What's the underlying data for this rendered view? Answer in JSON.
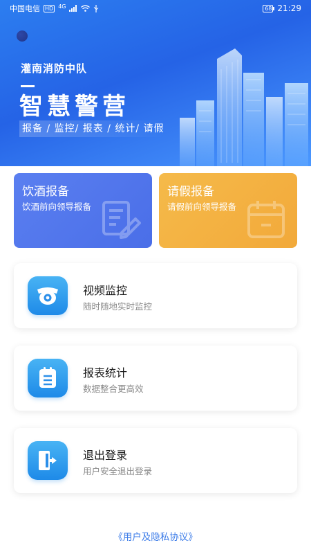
{
  "status_bar": {
    "carrier": "中国电信",
    "hd": "HD",
    "network": "4G",
    "battery": "68",
    "time": "21:29"
  },
  "hero": {
    "org": "灌南消防中队",
    "title": "智慧警营",
    "subtitle": "报备 / 监控/ 报表 / 统计/ 请假"
  },
  "top_cards": [
    {
      "title": "饮酒报备",
      "desc": "饮酒前向领导报备",
      "color": "#5a7ff0"
    },
    {
      "title": "请假报备",
      "desc": "请假前向领导报备",
      "color": "#f2a93a"
    }
  ],
  "menu": [
    {
      "title": "视频监控",
      "desc": "随时随地实时监控",
      "icon": "camera-icon"
    },
    {
      "title": "报表统计",
      "desc": "数据整合更高效",
      "icon": "document-icon"
    },
    {
      "title": "退出登录",
      "desc": "用户安全退出登录",
      "icon": "logout-icon"
    }
  ],
  "footer": {
    "link": "《用户及隐私协议》"
  },
  "colors": {
    "accent": "#2563e6",
    "icon_blue": "#1e8ae8",
    "link": "#3b7be8"
  }
}
